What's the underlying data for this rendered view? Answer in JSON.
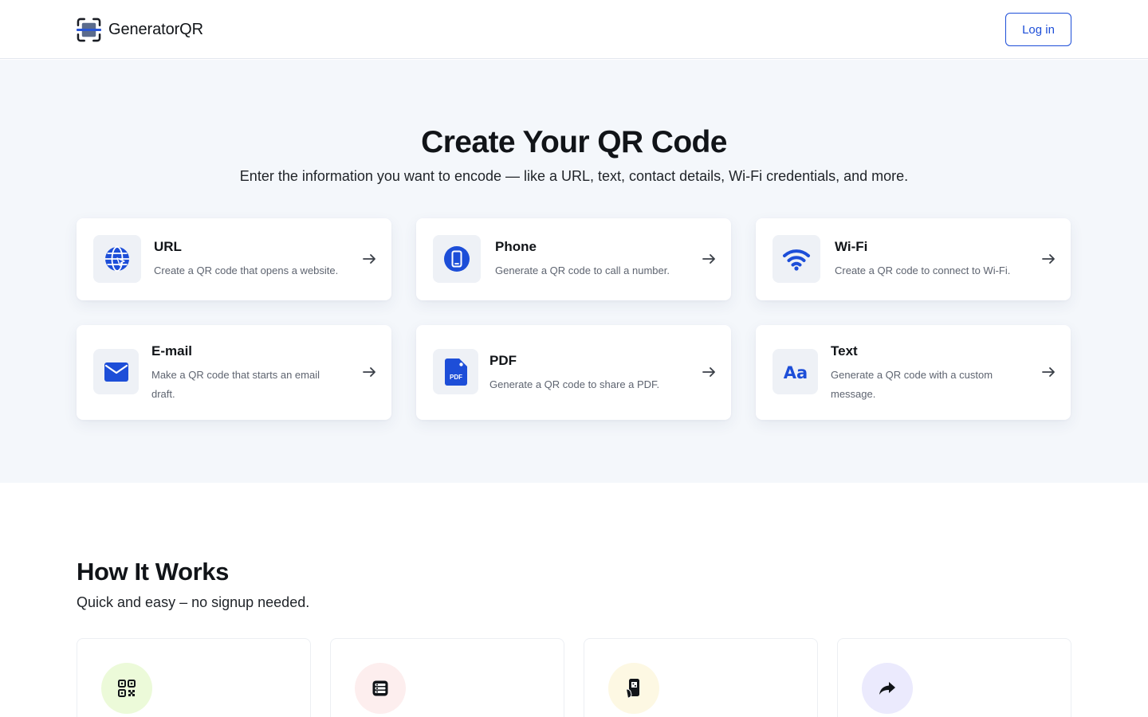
{
  "header": {
    "brand": "GeneratorQR",
    "login_label": "Log in"
  },
  "hero": {
    "title": "Create Your QR Code",
    "subtitle": "Enter the information you want to encode — like a URL, text, contact details, Wi-Fi credentials, and more."
  },
  "cards": [
    {
      "title": "URL",
      "description": "Create a QR code that opens a website.",
      "icon": "globe-icon"
    },
    {
      "title": "Phone",
      "description": "Generate a QR code to call a number.",
      "icon": "phone-icon"
    },
    {
      "title": "Wi-Fi",
      "description": "Create a QR code to connect to Wi-Fi.",
      "icon": "wifi-icon"
    },
    {
      "title": "E-mail",
      "description": "Make a QR code that starts an email draft.",
      "icon": "mail-icon"
    },
    {
      "title": "PDF",
      "description": "Generate a QR code to share a PDF.",
      "icon": "pdf-file-icon"
    },
    {
      "title": "Text",
      "description": "Generate a QR code with a custom message.",
      "icon": "text-aa-icon"
    }
  ],
  "how": {
    "title": "How It Works",
    "subtitle": "Quick and easy – no signup needed.",
    "steps": [
      {
        "icon": "qr-code-icon",
        "color": "#ecfad9"
      },
      {
        "icon": "qr-list-icon",
        "color": "#fdeeee"
      },
      {
        "icon": "phone-scan-icon",
        "color": "#fdf8e3"
      },
      {
        "icon": "share-arrow-icon",
        "color": "#ebeafd"
      }
    ]
  },
  "colors": {
    "accent": "#1d4ed8",
    "hero_background": "#f4f7fb"
  }
}
